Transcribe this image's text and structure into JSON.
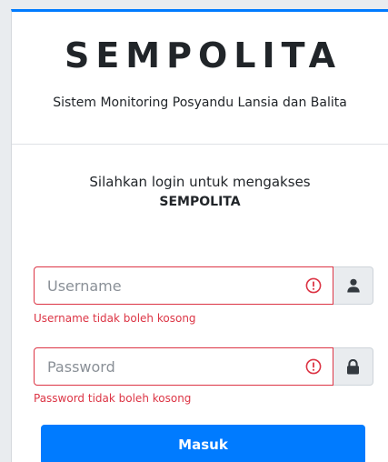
{
  "header": {
    "brand": "SEMPOLITA",
    "subtitle": "Sistem Monitoring Posyandu Lansia dan Balita"
  },
  "login": {
    "message": "Silahkan login untuk mengakses",
    "message_strong": "SEMPOLITA"
  },
  "form": {
    "username": {
      "placeholder": "Username",
      "value": "",
      "error": "Username tidak boleh kosong",
      "addon_icon": "user-icon",
      "status_icon": "exclamation-circle-icon"
    },
    "password": {
      "placeholder": "Password",
      "value": "",
      "error": "Password tidak boleh kosong",
      "addon_icon": "lock-icon",
      "status_icon": "exclamation-circle-icon"
    },
    "submit_label": "Masuk"
  },
  "colors": {
    "primary": "#007bff",
    "danger": "#dc3545",
    "addon_bg": "#e9ecef",
    "text": "#212529"
  }
}
